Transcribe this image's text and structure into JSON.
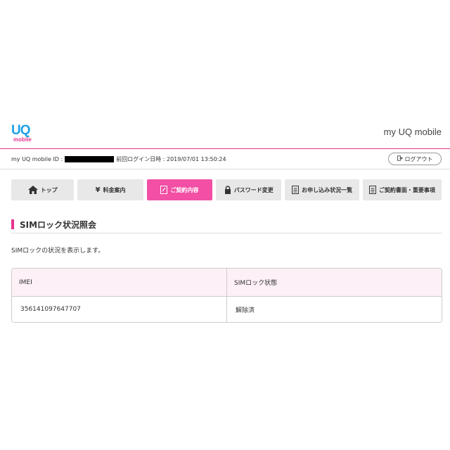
{
  "header": {
    "logo_uq": "UQ",
    "logo_mobile": "mobile",
    "site_title": "my UQ mobile"
  },
  "userbar": {
    "id_label": "my UQ mobile ID :",
    "last_login_label": "前回ログイン日時 : 2019/07/01 13:50:24",
    "logout_label": "ログアウト"
  },
  "nav": {
    "tabs": [
      {
        "label": "トップ",
        "icon": "home-icon"
      },
      {
        "label": "料金案内",
        "icon": "yen-icon"
      },
      {
        "label": "ご契約内容",
        "icon": "document-edit-icon",
        "active": true
      },
      {
        "label": "パスワード変更",
        "icon": "lock-icon"
      },
      {
        "label": "お申し込み状況一覧",
        "icon": "document-icon"
      },
      {
        "label": "ご契約書面・重要事項",
        "icon": "document-icon"
      }
    ]
  },
  "page": {
    "title": "SIMロック状況照会",
    "description": "SIMロックの状況を表示します。"
  },
  "table": {
    "headers": [
      "IMEI",
      "SIMロック状態"
    ],
    "rows": [
      [
        "356141097647707",
        "解除済"
      ]
    ]
  },
  "colors": {
    "accent": "#e8338c",
    "active_tab": "#f24fa5",
    "logo_blue": "#1ea0e6",
    "table_header_bg": "#fdf0f6"
  }
}
